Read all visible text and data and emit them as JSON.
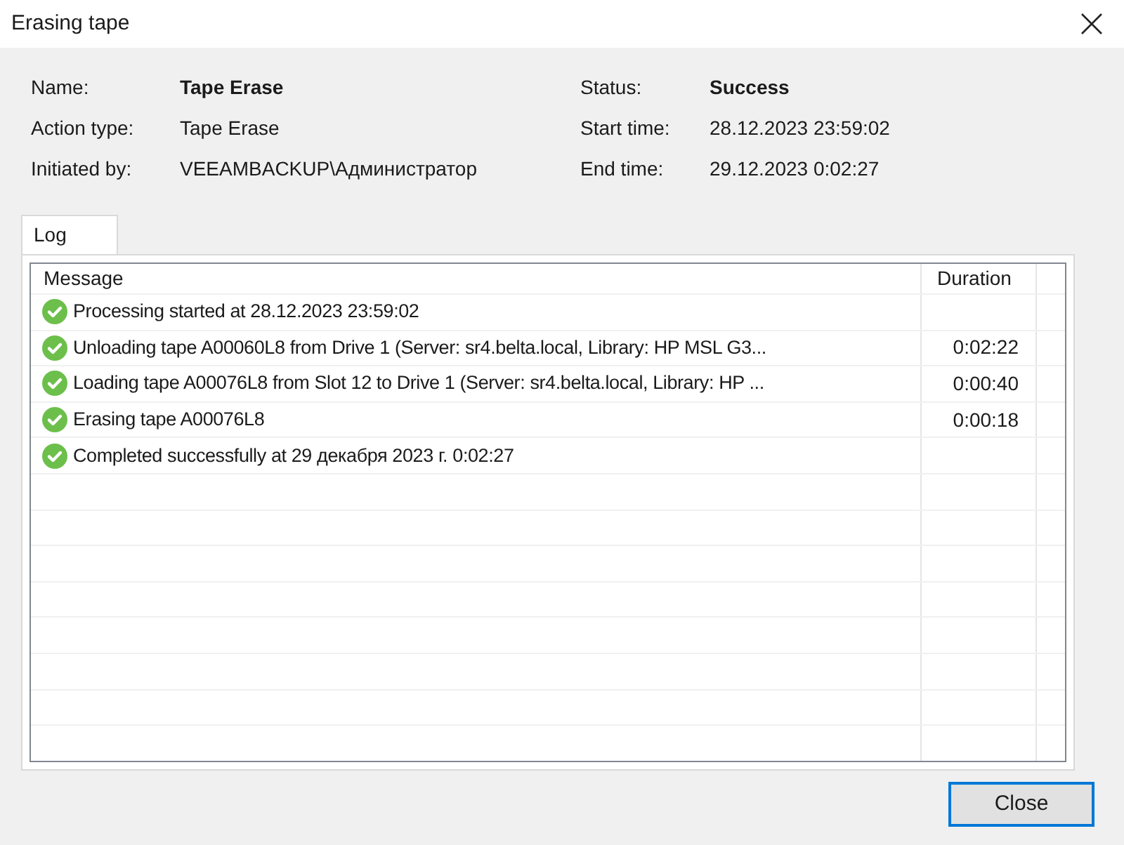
{
  "window": {
    "title": "Erasing tape"
  },
  "details": {
    "left": [
      {
        "label": "Name:",
        "value": "Tape Erase",
        "bold": true
      },
      {
        "label": "Action type:",
        "value": "Tape Erase",
        "bold": false
      },
      {
        "label": "Initiated by:",
        "value": "VEEAMBACKUP\\Администратор",
        "bold": false
      }
    ],
    "right": [
      {
        "label": "Status:",
        "value": "Success",
        "bold": true
      },
      {
        "label": "Start time:",
        "value": "28.12.2023 23:59:02",
        "bold": false
      },
      {
        "label": "End time:",
        "value": "29.12.2023 0:02:27",
        "bold": false
      }
    ]
  },
  "tabs": [
    {
      "label": "Log",
      "selected": true
    }
  ],
  "log": {
    "columns": [
      "Message",
      "Duration"
    ],
    "rows": [
      {
        "kind": "success",
        "message": "Processing started at 28.12.2023 23:59:02"
      },
      {
        "kind": "success",
        "message": "Unloading tape A00060L8 from Drive 1 (Server: sr4.belta.local, Library: HP MSL G3...",
        "duration": "0:02:22"
      },
      {
        "kind": "success",
        "message": "Loading tape A00076L8 from Slot 12 to Drive 1 (Server: sr4.belta.local, Library: HP ...",
        "duration": "0:00:40"
      },
      {
        "kind": "success",
        "message": "Erasing tape A00076L8",
        "duration": "0:00:18"
      },
      {
        "kind": "success",
        "message": "Completed successfully at 29 декабря 2023 г. 0:02:27"
      }
    ]
  },
  "buttons": [
    {
      "label": "Close"
    }
  ]
}
